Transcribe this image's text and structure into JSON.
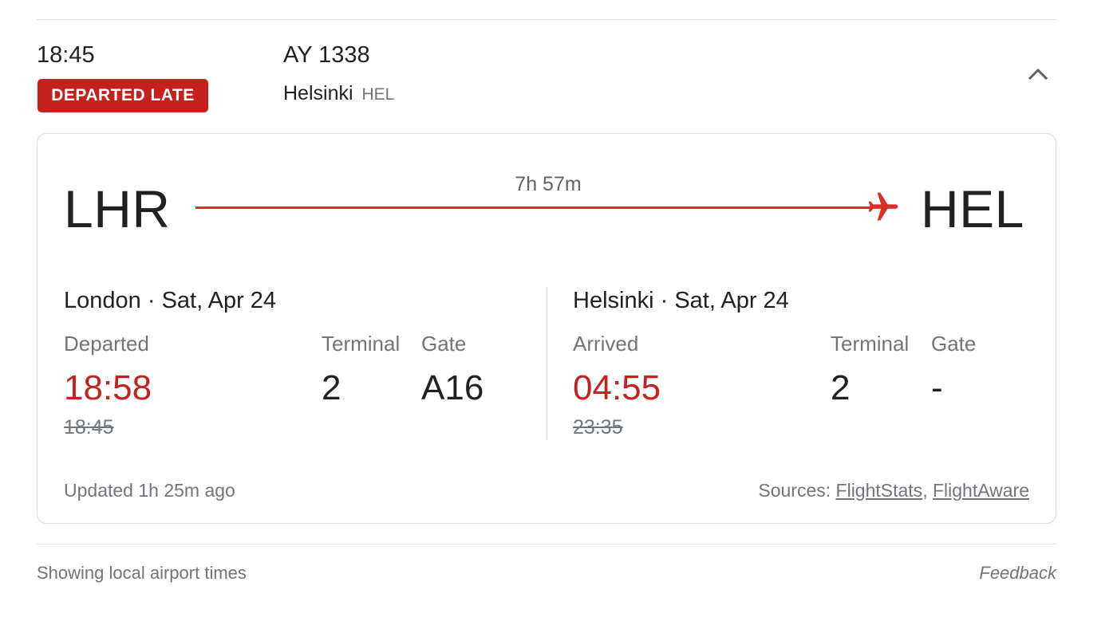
{
  "header": {
    "scheduled_time": "18:45",
    "status_badge": "DEPARTED LATE",
    "flight_number": "AY 1338",
    "destination_city": "Helsinki",
    "destination_code": "HEL",
    "collapse_icon": "chevron-up-icon"
  },
  "route": {
    "origin_code": "LHR",
    "destination_code": "HEL",
    "duration": "7h 57m",
    "plane_icon": "airplane-icon"
  },
  "departure": {
    "city": "London",
    "separator": "·",
    "date": "Sat, Apr 24",
    "status_label": "Departed",
    "actual_time": "18:58",
    "scheduled_time": "18:45",
    "terminal_label": "Terminal",
    "terminal": "2",
    "gate_label": "Gate",
    "gate": "A16"
  },
  "arrival": {
    "city": "Helsinki",
    "separator": "·",
    "date": "Sat, Apr 24",
    "status_label": "Arrived",
    "actual_time": "04:55",
    "scheduled_time": "23:35",
    "terminal_label": "Terminal",
    "terminal": "2",
    "gate_label": "Gate",
    "gate": "-"
  },
  "card_footer": {
    "updated": "Updated 1h 25m ago",
    "sources_label": "Sources:",
    "source_1": "FlightStats",
    "source_separator": ",",
    "source_2": "FlightAware"
  },
  "footer": {
    "note": "Showing local airport times",
    "feedback": "Feedback"
  },
  "colors": {
    "status_red": "#c5221f",
    "route_red": "#d93025",
    "text_primary": "#202124",
    "text_secondary": "#70757a",
    "border": "#dadce0"
  }
}
